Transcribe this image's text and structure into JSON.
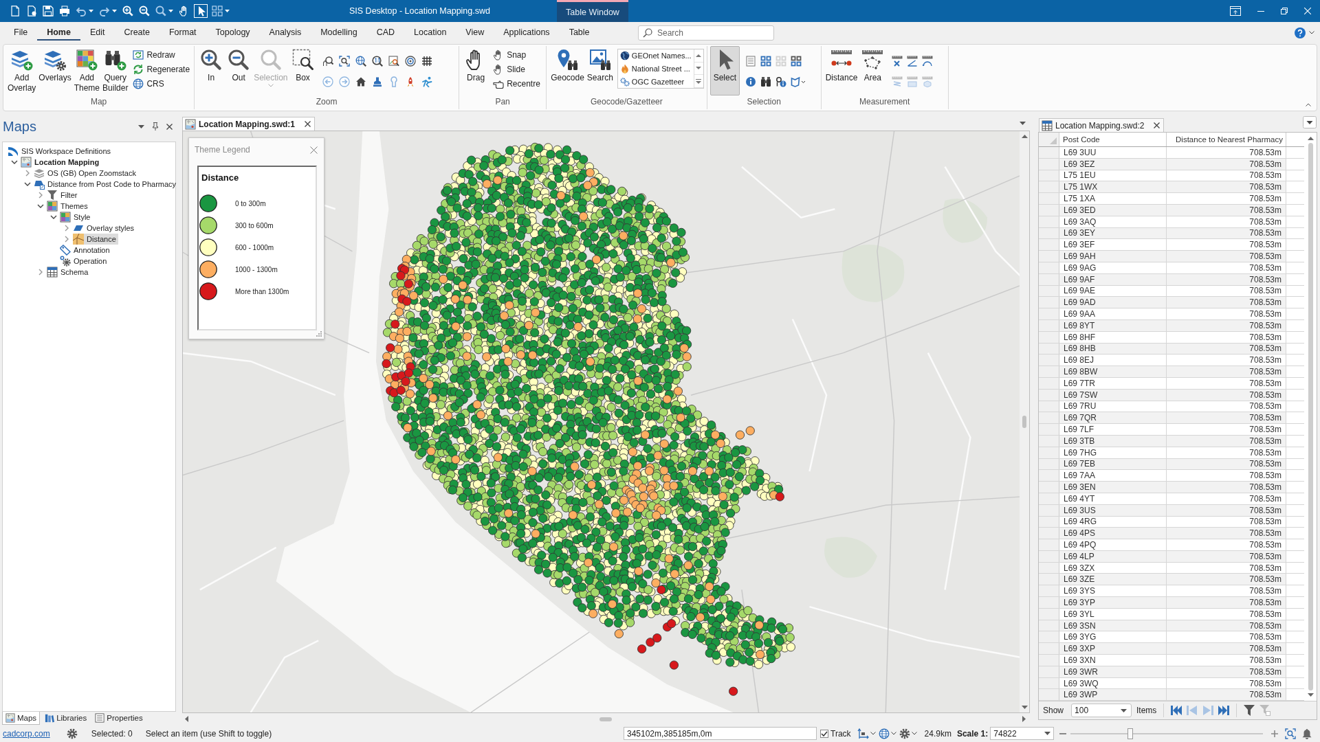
{
  "title_bar": {
    "title": "SIS Desktop - Location Mapping.swd",
    "context_tab": "Table Window"
  },
  "menu_tabs": [
    {
      "label": "File",
      "selected": false
    },
    {
      "label": "Home",
      "selected": true
    },
    {
      "label": "Edit",
      "selected": false
    },
    {
      "label": "Create",
      "selected": false
    },
    {
      "label": "Format",
      "selected": false
    },
    {
      "label": "Topology",
      "selected": false
    },
    {
      "label": "Analysis",
      "selected": false
    },
    {
      "label": "Modelling",
      "selected": false
    },
    {
      "label": "CAD",
      "selected": false
    },
    {
      "label": "Location",
      "selected": false
    },
    {
      "label": "View",
      "selected": false
    },
    {
      "label": "Applications",
      "selected": false
    },
    {
      "label": "Table",
      "selected": false
    }
  ],
  "search": {
    "placeholder": "Search"
  },
  "ribbon": {
    "groups": [
      {
        "kind": "map",
        "label": "Map",
        "buttons": [
          {
            "label": "Add Overlay"
          },
          {
            "label": "Overlays"
          },
          {
            "label": "Add Theme"
          },
          {
            "label": "Query Builder"
          }
        ],
        "commands": [
          "Redraw",
          "Regenerate",
          "CRS"
        ]
      },
      {
        "kind": "zoom",
        "label": "Zoom",
        "buttons": [
          {
            "label": "In",
            "disabled": false
          },
          {
            "label": "Out",
            "disabled": false
          },
          {
            "label": "Selection",
            "disabled": true
          },
          {
            "label": "Box",
            "disabled": false
          }
        ]
      },
      {
        "kind": "pan",
        "label": "Pan",
        "buttons": [
          {
            "label": "Drag"
          }
        ],
        "commands": [
          "Snap",
          "Slide",
          "Recentre"
        ]
      },
      {
        "kind": "geocode",
        "label": "Geocode/Gazetteer",
        "buttons": [
          {
            "label": "Geocode"
          },
          {
            "label": "Search"
          }
        ],
        "gazetteers": [
          "GEOnet Names...",
          "National Street ...",
          "OGC Gazetteer"
        ]
      },
      {
        "kind": "selection",
        "label": "Selection",
        "buttons": [
          {
            "label": "Select",
            "selected": true
          }
        ]
      },
      {
        "kind": "measurement",
        "label": "Measurement",
        "buttons": [
          {
            "label": "Distance"
          },
          {
            "label": "Area"
          }
        ]
      }
    ]
  },
  "maps_panel": {
    "title": "Maps",
    "tree": [
      {
        "label": "SIS Workspace Definitions",
        "kind": "workspace",
        "selected": false,
        "children": [
          {
            "label": "Location Mapping",
            "kind": "map",
            "expanded": true,
            "selected": false,
            "active": true,
            "children": [
              {
                "label": "OS (GB) Open Zoomstack",
                "kind": "layers",
                "expanded": false,
                "selected": false
              },
              {
                "label": "Distance from Post Code to Pharmacy",
                "kind": "overlay",
                "expanded": true,
                "selected": false,
                "children": [
                  {
                    "label": "Filter",
                    "kind": "filter",
                    "expanded": false,
                    "selected": false
                  },
                  {
                    "label": "Themes",
                    "kind": "themes",
                    "expanded": true,
                    "selected": false,
                    "children": [
                      {
                        "label": "Style",
                        "kind": "style",
                        "expanded": true,
                        "selected": false,
                        "children": [
                          {
                            "label": "Overlay styles",
                            "kind": "overlay-styles",
                            "expanded": false,
                            "selected": false
                          },
                          {
                            "label": "Distance",
                            "kind": "theme",
                            "expanded": false,
                            "selected": true
                          }
                        ]
                      },
                      {
                        "label": "Annotation",
                        "kind": "annotation",
                        "selected": false
                      },
                      {
                        "label": "Operation",
                        "kind": "operation",
                        "selected": false
                      }
                    ]
                  },
                  {
                    "label": "Schema",
                    "kind": "schema",
                    "expanded": false,
                    "selected": false
                  }
                ]
              }
            ]
          }
        ]
      }
    ],
    "bottom_tabs": [
      {
        "label": "Maps",
        "kind": "maps",
        "selected": true
      },
      {
        "label": "Libraries",
        "kind": "libraries",
        "selected": false
      },
      {
        "label": "Properties",
        "kind": "properties",
        "selected": false
      }
    ]
  },
  "map_window": {
    "tab": {
      "label": "Location Mapping.swd:1",
      "selected": true
    },
    "legend": {
      "title": "Theme Legend",
      "heading": "Distance",
      "items": [
        {
          "label": "0 to 300m",
          "color": "#1a9641"
        },
        {
          "label": "300 to 600m",
          "color": "#a6d96a"
        },
        {
          "label": "600 - 1000m",
          "color": "#ffffbf"
        },
        {
          "label": "1000 - 1300m",
          "color": "#fdae61"
        },
        {
          "label": "More than 1300m",
          "color": "#d7191c"
        }
      ]
    }
  },
  "table_window": {
    "tab": {
      "label": "Location Mapping.swd:2",
      "selected": false
    },
    "columns": [
      "Post Code",
      "Distance to Nearest Pharmacy"
    ],
    "rows": [
      [
        "L69 3UU",
        "708.53m"
      ],
      [
        "L69 3EZ",
        "708.53m"
      ],
      [
        "L75 1EU",
        "708.53m"
      ],
      [
        "L75 1WX",
        "708.53m"
      ],
      [
        "L75 1XA",
        "708.53m"
      ],
      [
        "L69 3ED",
        "708.53m"
      ],
      [
        "L69 3AQ",
        "708.53m"
      ],
      [
        "L69 3EY",
        "708.53m"
      ],
      [
        "L69 3EF",
        "708.53m"
      ],
      [
        "L69 9AH",
        "708.53m"
      ],
      [
        "L69 9AG",
        "708.53m"
      ],
      [
        "L69 9AF",
        "708.53m"
      ],
      [
        "L69 9AE",
        "708.53m"
      ],
      [
        "L69 9AD",
        "708.53m"
      ],
      [
        "L69 9AA",
        "708.53m"
      ],
      [
        "L69 8YT",
        "708.53m"
      ],
      [
        "L69 8HF",
        "708.53m"
      ],
      [
        "L69 8HB",
        "708.53m"
      ],
      [
        "L69 8EJ",
        "708.53m"
      ],
      [
        "L69 8BW",
        "708.53m"
      ],
      [
        "L69 7TR",
        "708.53m"
      ],
      [
        "L69 7SW",
        "708.53m"
      ],
      [
        "L69 7RU",
        "708.53m"
      ],
      [
        "L69 7QR",
        "708.53m"
      ],
      [
        "L69 7LF",
        "708.53m"
      ],
      [
        "L69 3TB",
        "708.53m"
      ],
      [
        "L69 7HG",
        "708.53m"
      ],
      [
        "L69 7EB",
        "708.53m"
      ],
      [
        "L69 7AA",
        "708.53m"
      ],
      [
        "L69 3EN",
        "708.53m"
      ],
      [
        "L69 4YT",
        "708.53m"
      ],
      [
        "L69 3US",
        "708.53m"
      ],
      [
        "L69 4RG",
        "708.53m"
      ],
      [
        "L69 4PS",
        "708.53m"
      ],
      [
        "L69 4PQ",
        "708.53m"
      ],
      [
        "L69 4LP",
        "708.53m"
      ],
      [
        "L69 3ZX",
        "708.53m"
      ],
      [
        "L69 3ZE",
        "708.53m"
      ],
      [
        "L69 3YS",
        "708.53m"
      ],
      [
        "L69 3YP",
        "708.53m"
      ],
      [
        "L69 3YL",
        "708.53m"
      ],
      [
        "L69 3SN",
        "708.53m"
      ],
      [
        "L69 3YG",
        "708.53m"
      ],
      [
        "L69 3XP",
        "708.53m"
      ],
      [
        "L69 3XN",
        "708.53m"
      ],
      [
        "L69 3WR",
        "708.53m"
      ],
      [
        "L69 3WQ",
        "708.53m"
      ],
      [
        "L69 3WP",
        "708.53m"
      ]
    ],
    "footer": {
      "show_label": "Show",
      "page_size": "100",
      "items_label": "Items"
    }
  },
  "status_bar": {
    "link": "cadcorp.com",
    "selected": "Selected: 0",
    "hint": "Select an item (use Shift to toggle)",
    "coordinates": "345102m,385185m,0m",
    "track": {
      "label": "Track",
      "checked": true
    },
    "extent": "24.9km",
    "scale_label": "Scale 1:",
    "scale": "74822",
    "zoom_slider": {
      "level": 0.31
    }
  }
}
